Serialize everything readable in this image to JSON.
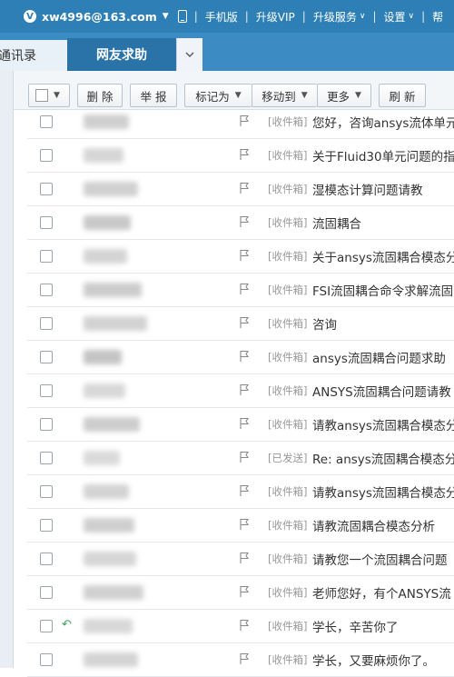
{
  "header": {
    "account": "xw4996@163.com",
    "links": [
      "手机版",
      "升级VIP",
      "升级服务",
      "设置",
      "帮"
    ]
  },
  "tabs": {
    "contacts": "通讯录",
    "active": "网友求助"
  },
  "toolbar": {
    "delete": "删 除",
    "report": "举 报",
    "mark_as": "标记为",
    "move_to": "移动到",
    "more": "更多",
    "refresh": "刷 新"
  },
  "colors": {
    "topbar": "#2d7fb5",
    "active_tab": "#2a73a8",
    "reply_arrow": "#3aa655"
  },
  "messages": [
    {
      "folder": "[收件箱]",
      "subject": "您好，咨询ansys流体单元",
      "replied": false
    },
    {
      "folder": "[收件箱]",
      "subject": "关于Fluid30单元问题的指",
      "replied": false
    },
    {
      "folder": "[收件箱]",
      "subject": "湿模态计算问题请教",
      "replied": false
    },
    {
      "folder": "[收件箱]",
      "subject": "流固耦合",
      "replied": false
    },
    {
      "folder": "[收件箱]",
      "subject": "关于ansys流固耦合模态分",
      "replied": false
    },
    {
      "folder": "[收件箱]",
      "subject": "FSI流固耦合命令求解流固",
      "replied": false
    },
    {
      "folder": "[收件箱]",
      "subject": "咨询",
      "replied": false
    },
    {
      "folder": "[收件箱]",
      "subject": "ansys流固耦合问题求助",
      "replied": false
    },
    {
      "folder": "[收件箱]",
      "subject": "ANSYS流固耦合问题请教",
      "replied": false
    },
    {
      "folder": "[收件箱]",
      "subject": "请教ansys流固耦合模态分",
      "replied": false
    },
    {
      "folder": "[已发送]",
      "subject": "Re: ansys流固耦合模态分",
      "replied": false
    },
    {
      "folder": "[收件箱]",
      "subject": "请教ansys流固耦合模态分",
      "replied": false
    },
    {
      "folder": "[收件箱]",
      "subject": "请教流固耦合模态分析",
      "replied": false
    },
    {
      "folder": "[收件箱]",
      "subject": "请教您一个流固耦合问题",
      "replied": false
    },
    {
      "folder": "[收件箱]",
      "subject": "老师您好，有个ANSYS流",
      "replied": false
    },
    {
      "folder": "[收件箱]",
      "subject": "学长，辛苦你了",
      "replied": true
    },
    {
      "folder": "[收件箱]",
      "subject": "学长，又要麻烦你了。",
      "replied": false
    }
  ]
}
